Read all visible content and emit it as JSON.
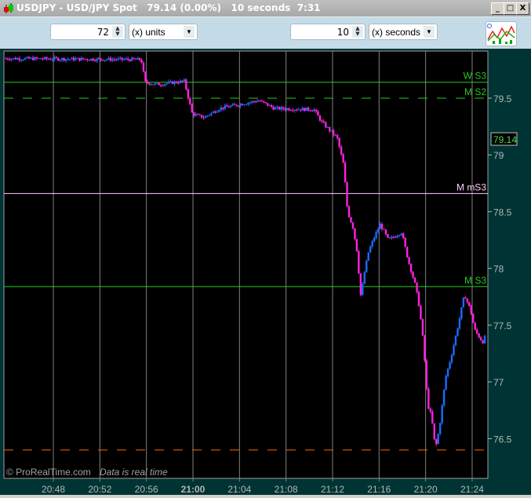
{
  "window": {
    "title": "USDJPY - USD/JPY Spot",
    "price": "79.14 (0.00%)",
    "interval": "10 seconds",
    "clock": "7:31",
    "minimize": "_",
    "maximize": "□",
    "close": "X"
  },
  "toolbar": {
    "units_value": "72",
    "units_label": "(x) units",
    "period_value": "10",
    "period_label": "(x) seconds"
  },
  "footer": {
    "copyright": "© ProRealTime.com",
    "realtime": "Data is real time"
  },
  "colors": {
    "up": "#1a6bff",
    "down": "#ff22dd",
    "grid": "#808080",
    "level_green": "#22cc22",
    "level_pink": "#ffccff",
    "level_orange": "#ff6600"
  },
  "chart_data": {
    "type": "candlestick",
    "symbol": "USDJPY",
    "bar_interval_seconds": 10,
    "time_unit": "minutes after 20:00",
    "xlim": [
      43.75,
      85.35
    ],
    "ylim": [
      76.15,
      79.915
    ],
    "x_ticks": [
      {
        "t": 48,
        "label": "20:48"
      },
      {
        "t": 52,
        "label": "20:52"
      },
      {
        "t": 56,
        "label": "20:56"
      },
      {
        "t": 60,
        "label": "21:00",
        "bold": true
      },
      {
        "t": 64,
        "label": "21:04"
      },
      {
        "t": 68,
        "label": "21:08"
      },
      {
        "t": 72,
        "label": "21:12"
      },
      {
        "t": 76,
        "label": "21:16"
      },
      {
        "t": 80,
        "label": "21:20"
      },
      {
        "t": 84,
        "label": "21:24"
      }
    ],
    "y_ticks": [
      {
        "v": 79.5,
        "label": "79.5"
      },
      {
        "v": 79,
        "label": "79"
      },
      {
        "v": 78.5,
        "label": "78.5"
      },
      {
        "v": 78,
        "label": "78"
      },
      {
        "v": 77.5,
        "label": "77.5"
      },
      {
        "v": 77,
        "label": "77"
      },
      {
        "v": 76.5,
        "label": "76.5"
      }
    ],
    "last_price_label": "79.14",
    "levels": [
      {
        "name": "W S3",
        "value": 79.64,
        "style": "solid",
        "color": "#22cc22"
      },
      {
        "name": "M S2",
        "value": 79.5,
        "style": "dashed",
        "color": "#22cc22"
      },
      {
        "name": "M mS3",
        "value": 78.66,
        "style": "solid",
        "color": "#ffccff"
      },
      {
        "name": "M S3",
        "value": 77.84,
        "style": "solid",
        "color": "#22cc22"
      },
      {
        "name": "",
        "value": 76.4,
        "style": "dashed",
        "color": "#ff6600"
      }
    ],
    "price_path": [
      [
        43.75,
        79.85
      ],
      [
        55.55,
        79.84
      ],
      [
        55.89,
        79.64
      ],
      [
        56.9,
        79.62
      ],
      [
        59.26,
        79.65
      ],
      [
        59.94,
        79.36
      ],
      [
        60.95,
        79.33
      ],
      [
        62.3,
        79.41
      ],
      [
        65.67,
        79.48
      ],
      [
        67.0,
        79.41
      ],
      [
        70.4,
        79.4
      ],
      [
        71.06,
        79.29
      ],
      [
        72.4,
        79.15
      ],
      [
        72.95,
        78.91
      ],
      [
        73.29,
        78.5
      ],
      [
        73.76,
        78.36
      ],
      [
        74.1,
        78.15
      ],
      [
        74.43,
        77.75
      ],
      [
        74.77,
        77.98
      ],
      [
        75.1,
        78.15
      ],
      [
        75.65,
        78.29
      ],
      [
        76.1,
        78.39
      ],
      [
        76.8,
        78.25
      ],
      [
        77.47,
        78.29
      ],
      [
        77.94,
        78.32
      ],
      [
        78.48,
        78.08
      ],
      [
        79.15,
        77.84
      ],
      [
        79.5,
        77.63
      ],
      [
        79.83,
        77.32
      ],
      [
        80.17,
        76.8
      ],
      [
        80.5,
        76.7
      ],
      [
        80.84,
        76.41
      ],
      [
        81.18,
        76.59
      ],
      [
        81.72,
        77.04
      ],
      [
        82.19,
        77.22
      ],
      [
        82.86,
        77.53
      ],
      [
        83.33,
        77.77
      ],
      [
        83.87,
        77.63
      ],
      [
        84.2,
        77.46
      ],
      [
        84.9,
        77.35
      ],
      [
        85.2,
        77.42
      ]
    ]
  }
}
